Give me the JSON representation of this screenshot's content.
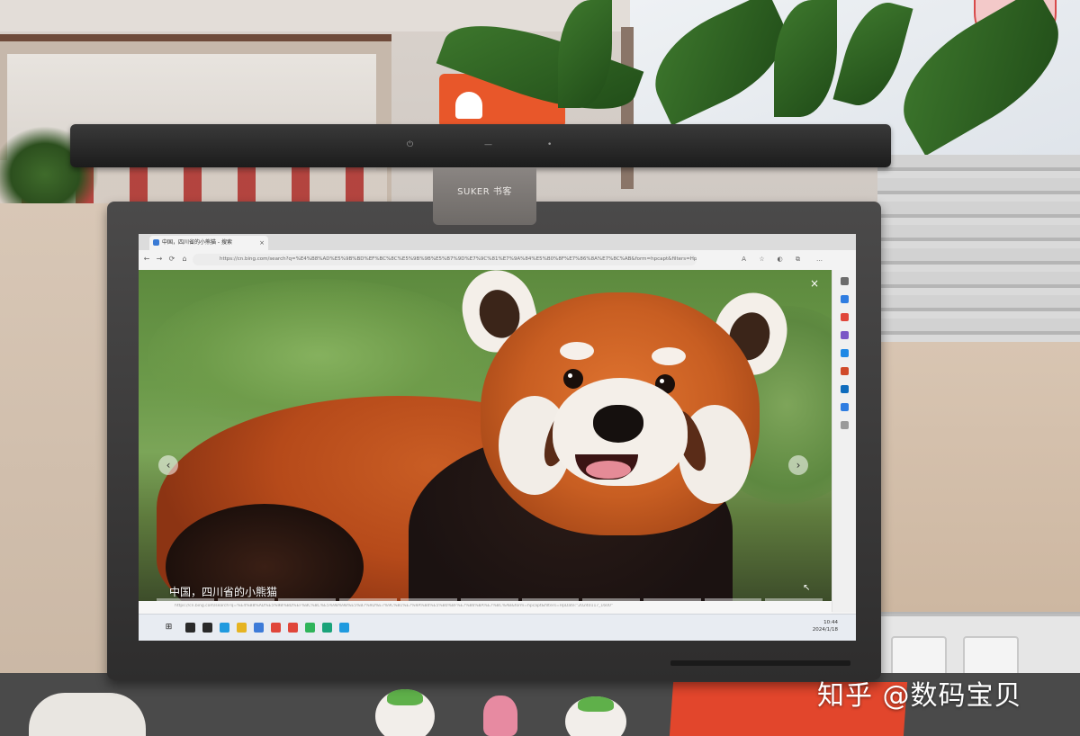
{
  "lightbar": {
    "brand": "SUKER 书客",
    "controls": [
      "⏻",
      "—",
      "•"
    ]
  },
  "browser": {
    "tab_title": "中国，四川省的小熊猫 - 搜索",
    "tab_close": "×",
    "nav": [
      "←",
      "→",
      "⟳",
      "⌂"
    ],
    "url": "https://cn.bing.com/search?q=%E4%B8%AD%E5%9B%BD%EF%BC%8C%E5%9B%9B%E5%B7%9D%E7%9C%81%E7%9A%84%E5%B0%8F%E7%86%8A%E7%8C%AB&form=hpcapt&filters=HpDate:\"20240117_1600\"",
    "toolbar_icons": [
      "A",
      "☆",
      "◐",
      "⧉",
      "…"
    ]
  },
  "viewer": {
    "caption": "中国，四川省的小熊猫",
    "close": "×",
    "prev": "‹",
    "next": "›",
    "thumb_count": 11
  },
  "sidebar_icons": [
    {
      "name": "search-icon",
      "color": "#6b6b6b"
    },
    {
      "name": "copilot-icon",
      "color": "#2f7de1"
    },
    {
      "name": "shopping-icon",
      "color": "#e0463a"
    },
    {
      "name": "tools-icon",
      "color": "#7b57c6"
    },
    {
      "name": "games-icon",
      "color": "#1e88e5"
    },
    {
      "name": "office-icon",
      "color": "#d04a2a"
    },
    {
      "name": "outlook-icon",
      "color": "#0f6cbd"
    },
    {
      "name": "send-icon",
      "color": "#2f7de1"
    },
    {
      "name": "add-icon",
      "color": "#9a9a9a"
    }
  ],
  "taskbar": {
    "start": "⊞",
    "apps": [
      {
        "name": "search-taskbar-icon",
        "color": "#2a2a2a"
      },
      {
        "name": "taskview-icon",
        "color": "#2a2a2a"
      },
      {
        "name": "edge-icon",
        "color": "#1f9adf"
      },
      {
        "name": "file-explorer-icon",
        "color": "#e6b422"
      },
      {
        "name": "store-icon",
        "color": "#3d7bd8"
      },
      {
        "name": "chrome-icon",
        "color": "#e0463a"
      },
      {
        "name": "wps-icon",
        "color": "#e0463a"
      },
      {
        "name": "wechat-icon",
        "color": "#2fb45a"
      },
      {
        "name": "app-icon",
        "color": "#1aa37a"
      },
      {
        "name": "edge-taskbar-icon",
        "color": "#1f9adf"
      }
    ],
    "clock_time": "10:44",
    "clock_date": "2024/1/18"
  },
  "watermark": "知乎 @数码宝贝"
}
